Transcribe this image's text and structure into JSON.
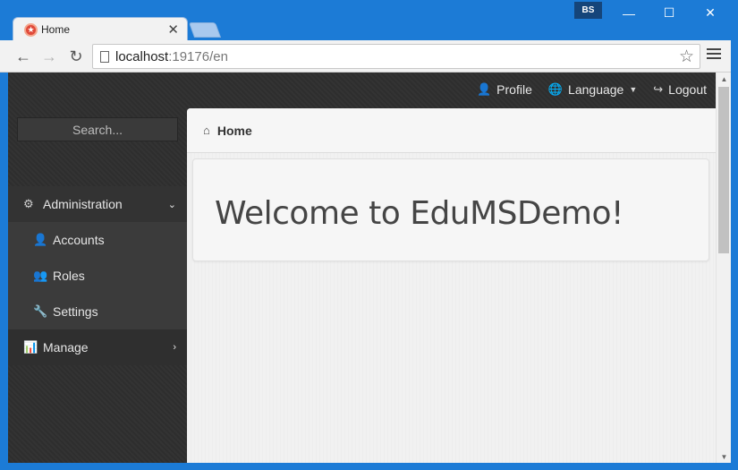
{
  "browser": {
    "tab_title": "Home",
    "tab_close": "✕",
    "profile_badge": "BS",
    "url_host": "localhost",
    "url_rest": ":19176/en",
    "window_minimize": "—",
    "window_maximize": "☐",
    "window_close": "✕"
  },
  "topnav": {
    "profile": "Profile",
    "language": "Language",
    "logout": "Logout"
  },
  "sidebar": {
    "search_placeholder": "Search...",
    "items": [
      {
        "label": "Administration",
        "icon": "cogs-icon",
        "expanded": true
      },
      {
        "label": "Accounts",
        "icon": "user-icon"
      },
      {
        "label": "Roles",
        "icon": "users-icon"
      },
      {
        "label": "Settings",
        "icon": "wrench-icon"
      },
      {
        "label": "Manage",
        "icon": "bar-chart-icon",
        "expanded": false
      }
    ]
  },
  "main": {
    "breadcrumb": "Home",
    "welcome": "Welcome to EduMSDemo!"
  },
  "colors": {
    "window_frame": "#1c7bd6",
    "sidebar_bg": "#2f2f2f",
    "content_bg": "#f1f1f1"
  }
}
